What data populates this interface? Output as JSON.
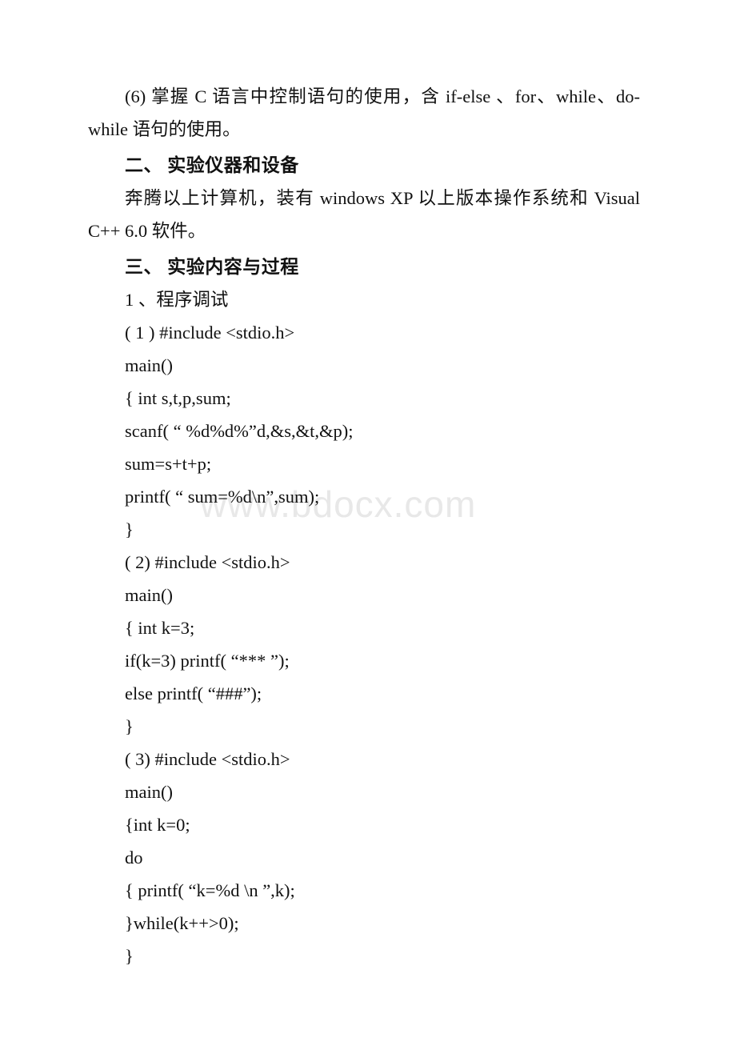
{
  "watermark": {
    "text": "www.bdocx.com"
  },
  "document": {
    "objective_item": "(6) 掌握 C 语言中控制语句的使用，含 if-else 、for、while、do-while 语句的使用。",
    "section_two": {
      "heading": "二、 实验仪器和设备",
      "body": "奔腾以上计算机，装有 windows XP 以上版本操作系统和 Visual C++ 6.0 软件。"
    },
    "section_three": {
      "heading": "三、 实验内容与过程",
      "subheading": "1 、程序调试",
      "programs": [
        {
          "label": "( 1 ) #include <stdio.h>",
          "lines": [
            "main()",
            "{ int s,t,p,sum;",
            "scanf( “ %d%d%”d,&s,&t,&p);",
            "sum=s+t+p;",
            "printf( “ sum=%d\\n”,sum);",
            "}"
          ]
        },
        {
          "label": "( 2) #include <stdio.h>",
          "lines": [
            "main()",
            "{ int k=3;",
            "if(k=3) printf( “*** ”);",
            "else printf( “###”);",
            "}"
          ]
        },
        {
          "label": "( 3) #include <stdio.h>",
          "lines": [
            "main()",
            "{int k=0;",
            "do",
            "{ printf( “k=%d \\n ”,k);",
            "}while(k++>0);",
            "}"
          ]
        }
      ]
    }
  }
}
